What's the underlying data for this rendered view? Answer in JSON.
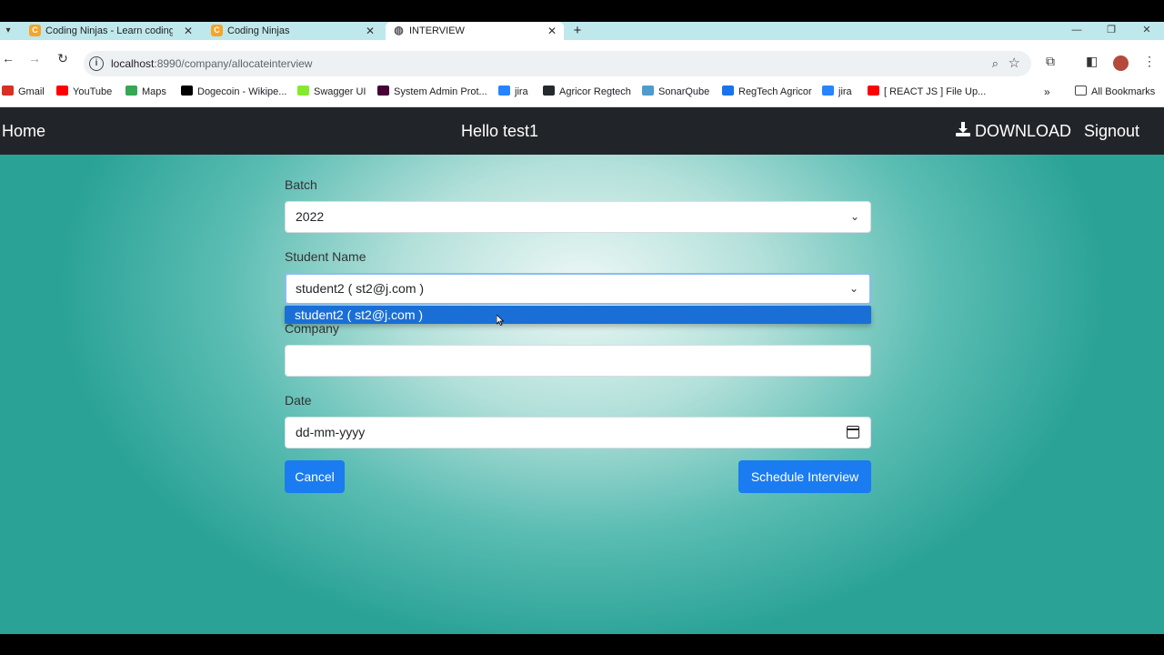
{
  "browser": {
    "tabs": [
      {
        "title": "Coding Ninjas - Learn coding o",
        "icon": "coding-ninjas-icon"
      },
      {
        "title": "Coding Ninjas",
        "icon": "coding-ninjas-icon"
      },
      {
        "title": "INTERVIEW",
        "icon": "globe-icon",
        "active": true
      }
    ],
    "url_host": "localhost",
    "url_rest": ":8990/company/allocateinterview",
    "bookmarks": [
      {
        "label": "Gmail",
        "color": "#d93025"
      },
      {
        "label": "YouTube",
        "color": "#ff0000"
      },
      {
        "label": "Maps",
        "color": "#34a853"
      },
      {
        "label": "Dogecoin - Wikipe...",
        "color": "#000000"
      },
      {
        "label": "Swagger UI",
        "color": "#85ea2d"
      },
      {
        "label": "System Admin Prot...",
        "color": "#470137"
      },
      {
        "label": "jira",
        "color": "#2684ff"
      },
      {
        "label": "Agricor Regtech",
        "color": "#24292f"
      },
      {
        "label": "SonarQube",
        "color": "#4e9bcd"
      },
      {
        "label": "RegTech Agricor",
        "color": "#1a73e8"
      },
      {
        "label": "jira",
        "color": "#2684ff"
      },
      {
        "label": "[ REACT JS ] File Up...",
        "color": "#ff0000"
      }
    ],
    "all_bookmarks": "All Bookmarks"
  },
  "nav": {
    "home": "Home",
    "greeting": "Hello test1",
    "download": "DOWNLOAD",
    "signout": "Signout"
  },
  "form": {
    "batch_label": "Batch",
    "batch_value": "2022",
    "student_label": "Student Name",
    "student_value": "student2 ( st2@j.com )",
    "student_options": [
      "student2 ( st2@j.com )"
    ],
    "company_label": "Company",
    "company_value": "",
    "date_label": "Date",
    "date_placeholder": "dd-mm-yyyy",
    "cancel": "Cancel",
    "schedule": "Schedule Interview"
  },
  "colors": {
    "navbar": "#212529",
    "primary": "#1a7cf0",
    "dropdown_highlight": "#1a6fd6"
  }
}
